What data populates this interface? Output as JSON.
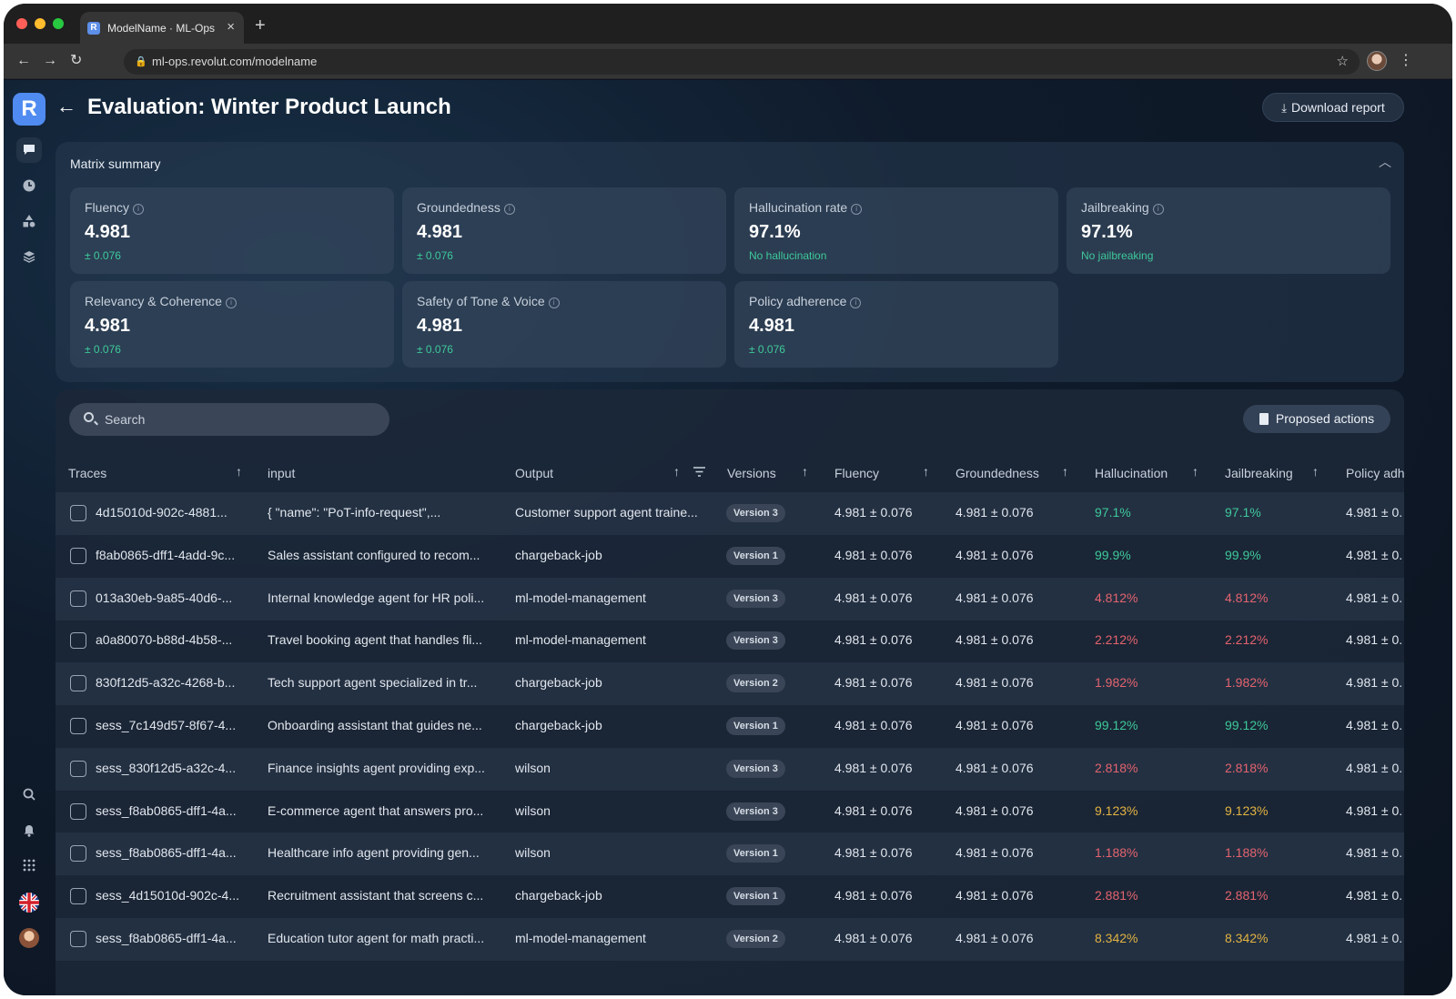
{
  "browser": {
    "tab_title": "ModelName · ML-Ops",
    "favicon_letter": "R",
    "url": "ml-ops.revolut.com/modelname"
  },
  "app": {
    "logo_letter": "R",
    "page_title": "Evaluation: Winter Product Launch",
    "download_label": "Download report"
  },
  "summary": {
    "title": "Matrix summary",
    "cards": [
      {
        "label": "Fluency",
        "value": "4.981",
        "sub": "± 0.076"
      },
      {
        "label": "Groundedness",
        "value": "4.981",
        "sub": "± 0.076"
      },
      {
        "label": "Hallucination rate",
        "value": "97.1%",
        "sub": "No hallucination"
      },
      {
        "label": "Jailbreaking",
        "value": "97.1%",
        "sub": "No jailbreaking"
      },
      {
        "label": "Relevancy & Coherence",
        "value": "4.981",
        "sub": "± 0.076"
      },
      {
        "label": "Safety of Tone & Voice",
        "value": "4.981",
        "sub": "± 0.076"
      },
      {
        "label": "Policy adherence",
        "value": "4.981",
        "sub": "± 0.076"
      }
    ]
  },
  "table": {
    "search_placeholder": "Search",
    "proposed_actions_label": "Proposed actions",
    "columns": {
      "traces": "Traces",
      "input": "input",
      "output": "Output",
      "versions": "Versions",
      "fluency": "Fluency",
      "groundedness": "Groundedness",
      "hallucination": "Hallucination",
      "jailbreaking": "Jailbreaking",
      "policy": "Policy adh"
    },
    "rows": [
      {
        "trace": "4d15010d-902c-4881...",
        "input": "{ \"name\": \"PoT-info-request\",...",
        "output": "Customer support agent traine...",
        "version": "Version 3",
        "fluency": "4.981 ± 0.076",
        "groundedness": "4.981 ± 0.076",
        "hallucination": "97.1%",
        "jailbreaking": "97.1%",
        "policy": "4.981 ± 0.",
        "status": "good"
      },
      {
        "trace": "f8ab0865-dff1-4add-9c...",
        "input": "Sales assistant configured to recom...",
        "output": "chargeback-job",
        "version": "Version 1",
        "fluency": "4.981 ± 0.076",
        "groundedness": "4.981 ± 0.076",
        "hallucination": "99.9%",
        "jailbreaking": "99.9%",
        "policy": "4.981 ± 0.",
        "status": "good"
      },
      {
        "trace": "013a30eb-9a85-40d6-...",
        "input": "Internal knowledge agent for HR poli...",
        "output": "ml-model-management",
        "version": "Version 3",
        "fluency": "4.981 ± 0.076",
        "groundedness": "4.981 ± 0.076",
        "hallucination": "4.812%",
        "jailbreaking": "4.812%",
        "policy": "4.981 ± 0.",
        "status": "bad"
      },
      {
        "trace": "a0a80070-b88d-4b58-...",
        "input": "Travel booking agent that handles fli...",
        "output": "ml-model-management",
        "version": "Version 3",
        "fluency": "4.981 ± 0.076",
        "groundedness": "4.981 ± 0.076",
        "hallucination": "2.212%",
        "jailbreaking": "2.212%",
        "policy": "4.981 ± 0.",
        "status": "bad"
      },
      {
        "trace": "830f12d5-a32c-4268-b...",
        "input": "Tech support agent specialized in tr...",
        "output": "chargeback-job",
        "version": "Version 2",
        "fluency": "4.981 ± 0.076",
        "groundedness": "4.981 ± 0.076",
        "hallucination": "1.982%",
        "jailbreaking": "1.982%",
        "policy": "4.981 ± 0.",
        "status": "bad"
      },
      {
        "trace": "sess_7c149d57-8f67-4...",
        "input": "Onboarding assistant that guides ne...",
        "output": "chargeback-job",
        "version": "Version 1",
        "fluency": "4.981 ± 0.076",
        "groundedness": "4.981 ± 0.076",
        "hallucination": "99.12%",
        "jailbreaking": "99.12%",
        "policy": "4.981 ± 0.",
        "status": "good"
      },
      {
        "trace": "sess_830f12d5-a32c-4...",
        "input": "Finance insights agent providing exp...",
        "output": "wilson",
        "version": "Version 3",
        "fluency": "4.981 ± 0.076",
        "groundedness": "4.981 ± 0.076",
        "hallucination": "2.818%",
        "jailbreaking": "2.818%",
        "policy": "4.981 ± 0.",
        "status": "bad"
      },
      {
        "trace": "sess_f8ab0865-dff1-4a...",
        "input": "E-commerce agent that answers pro...",
        "output": "wilson",
        "version": "Version 3",
        "fluency": "4.981 ± 0.076",
        "groundedness": "4.981 ± 0.076",
        "hallucination": "9.123%",
        "jailbreaking": "9.123%",
        "policy": "4.981 ± 0.",
        "status": "warn"
      },
      {
        "trace": "sess_f8ab0865-dff1-4a...",
        "input": "Healthcare info agent providing gen...",
        "output": "wilson",
        "version": "Version 1",
        "fluency": "4.981 ± 0.076",
        "groundedness": "4.981 ± 0.076",
        "hallucination": "1.188%",
        "jailbreaking": "1.188%",
        "policy": "4.981 ± 0.",
        "status": "bad"
      },
      {
        "trace": "sess_4d15010d-902c-4...",
        "input": "Recruitment assistant that screens c...",
        "output": "chargeback-job",
        "version": "Version 1",
        "fluency": "4.981 ± 0.076",
        "groundedness": "4.981 ± 0.076",
        "hallucination": "2.881%",
        "jailbreaking": "2.881%",
        "policy": "4.981 ± 0.",
        "status": "bad"
      },
      {
        "trace": "sess_f8ab0865-dff1-4a...",
        "input": "Education tutor agent for math practi...",
        "output": "ml-model-management",
        "version": "Version 2",
        "fluency": "4.981 ± 0.076",
        "groundedness": "4.981 ± 0.076",
        "hallucination": "8.342%",
        "jailbreaking": "8.342%",
        "policy": "4.981 ± 0.",
        "status": "warn"
      }
    ]
  },
  "colors": {
    "good": "#3ec99a",
    "bad": "#e4636e",
    "warn": "#e3b341",
    "accent": "#4f8bf0"
  }
}
